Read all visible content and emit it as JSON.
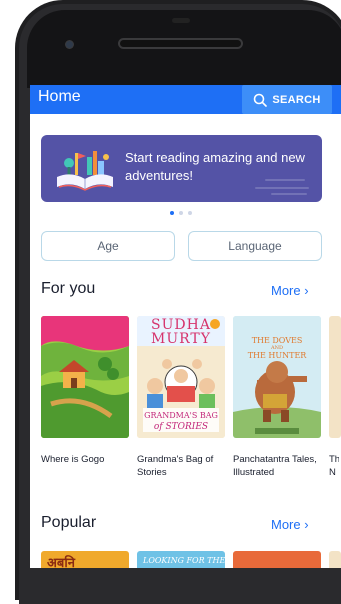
{
  "app": {
    "title": "Home",
    "search_label": "SEARCH"
  },
  "banner": {
    "text": "Start reading amazing and new adventures!"
  },
  "carousel": {
    "slide_count": 3,
    "active_slide": 1
  },
  "filters": {
    "age": "Age",
    "language": "Language"
  },
  "sections": {
    "for_you": {
      "title": "For you",
      "more": "More ›",
      "books": [
        {
          "title": "Where is Gogo"
        },
        {
          "title": "Grandma's Bag of Stories",
          "cover_text": [
            "SUDHA",
            "MURTY",
            "GRANDMA'S BAG",
            "of STORIES"
          ]
        },
        {
          "title": "Panchatantra Tales, Illustrated",
          "cover_text": [
            "THE DOVES",
            "AND",
            "THE HUNTER"
          ]
        },
        {
          "title": "Th N"
        }
      ]
    },
    "popular": {
      "title": "Popular",
      "more": "More ›",
      "covers": [
        "अबनि",
        "LOOKING FOR THE"
      ]
    }
  },
  "colors": {
    "primary": "#1e6ff5",
    "banner": "#5453a6",
    "filter_border": "#b9d8e8"
  }
}
